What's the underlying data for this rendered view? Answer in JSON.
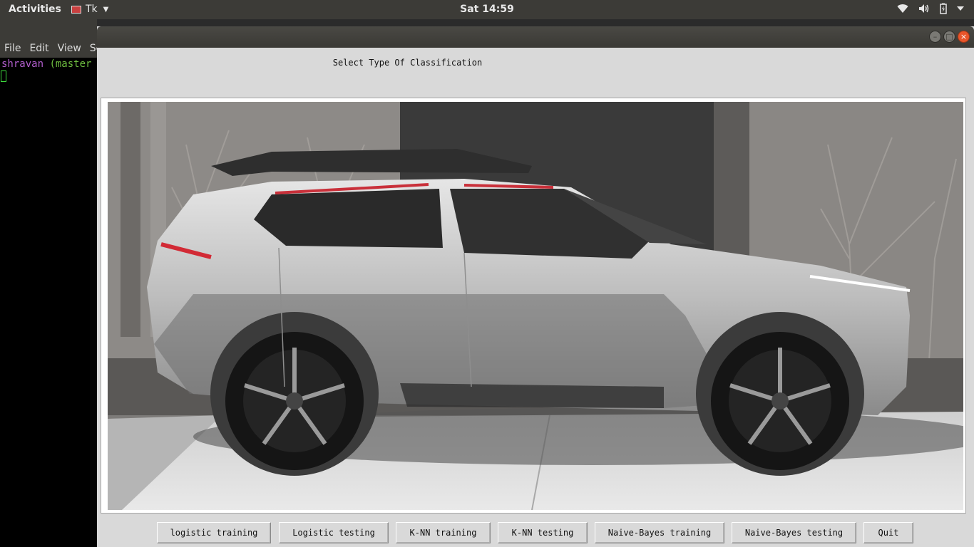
{
  "topbar": {
    "activities": "Activities",
    "app_name": "Tk",
    "clock": "Sat 14:59",
    "tray_icons": [
      "wifi-icon",
      "volume-icon",
      "battery-icon",
      "power-menu-icon"
    ]
  },
  "terminal": {
    "menu": [
      "File",
      "Edit",
      "View",
      "Se"
    ],
    "prompt_user": "shravan",
    "prompt_branch": "(master"
  },
  "tk_window": {
    "heading": "Select Type Of Classification",
    "image_subject": "car-photo",
    "buttons": [
      {
        "label": "logistic training"
      },
      {
        "label": "Logistic testing"
      },
      {
        "label": "K-NN training"
      },
      {
        "label": "K-NN testing"
      },
      {
        "label": "Naive-Bayes training"
      },
      {
        "label": "Naive-Bayes testing"
      },
      {
        "label": "Quit"
      }
    ],
    "colors": {
      "window_bg": "#d9d9d9",
      "close_button": "#e9552a"
    }
  }
}
